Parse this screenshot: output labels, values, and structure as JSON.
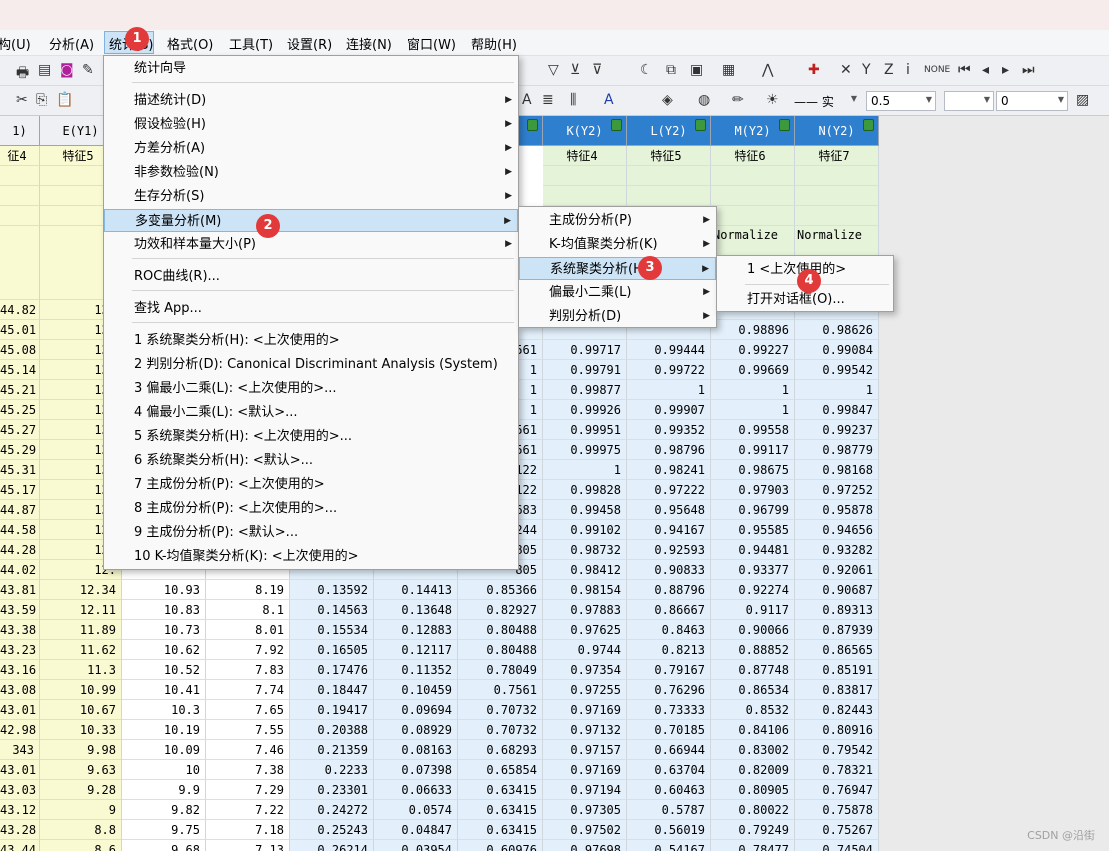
{
  "menubar": {
    "items": [
      "构(U)",
      "分析(A)",
      "统计(S)",
      "格式(O)",
      "工具(T)",
      "设置(R)",
      "连接(N)",
      "窗口(W)",
      "帮助(H)"
    ],
    "active_label": "统计(S)"
  },
  "toolbar": {
    "line_style": "—— 实",
    "line_width": "0.5",
    "number": "0"
  },
  "columns": {
    "left": [
      {
        "name": "1)",
        "label": "征4"
      },
      {
        "name": "E(Y1)",
        "label": "特征5"
      }
    ],
    "right": [
      {
        "name": "K(Y2)",
        "label": "特征4"
      },
      {
        "name": "L(Y2)",
        "label": "特征5"
      },
      {
        "name": "M(Y2)",
        "label": "特征6"
      },
      {
        "name": "N(Y2)",
        "label": "特征7"
      }
    ]
  },
  "extra_header": "Normalize",
  "data_rows": [
    [
      "44.82",
      "13.",
      "",
      "",
      "",
      "",
      "",
      "",
      "",
      "",
      ""
    ],
    [
      "45.01",
      "13.",
      "",
      "",
      "",
      "",
      "",
      "",
      "",
      "0.98896",
      "0.98626"
    ],
    [
      "45.08",
      "13.",
      "",
      "",
      "",
      "",
      "561",
      "0.99717",
      "0.99444",
      "0.99227",
      "0.99084"
    ],
    [
      "45.14",
      "13.",
      "",
      "",
      "",
      "",
      "1",
      "0.99791",
      "0.99722",
      "0.99669",
      "0.99542"
    ],
    [
      "45.21",
      "13.",
      "",
      "",
      "",
      "",
      "1",
      "0.99877",
      "1",
      "1",
      "1"
    ],
    [
      "45.25",
      "13.",
      "",
      "",
      "",
      "",
      "1",
      "0.99926",
      "0.99907",
      "1",
      "0.99847"
    ],
    [
      "45.27",
      "13.",
      "",
      "",
      "",
      "",
      "561",
      "0.99951",
      "0.99352",
      "0.99558",
      "0.99237"
    ],
    [
      "45.29",
      "13.",
      "",
      "",
      "",
      "",
      "561",
      "0.99975",
      "0.98796",
      "0.99117",
      "0.98779"
    ],
    [
      "45.31",
      "13.",
      "",
      "",
      "",
      "",
      "122",
      "1",
      "0.98241",
      "0.98675",
      "0.98168"
    ],
    [
      "45.17",
      "13.",
      "",
      "",
      "",
      "",
      "122",
      "0.99828",
      "0.97222",
      "0.97903",
      "0.97252"
    ],
    [
      "44.87",
      "13.",
      "",
      "",
      "",
      "",
      "683",
      "0.99458",
      "0.95648",
      "0.96799",
      "0.95878"
    ],
    [
      "44.58",
      "12.",
      "",
      "",
      "",
      "",
      "244",
      "0.99102",
      "0.94167",
      "0.95585",
      "0.94656"
    ],
    [
      "44.28",
      "12.",
      "",
      "",
      "",
      "",
      "805",
      "0.98732",
      "0.92593",
      "0.94481",
      "0.93282"
    ],
    [
      "44.02",
      "12.",
      "",
      "",
      "",
      "",
      "805",
      "0.98412",
      "0.90833",
      "0.93377",
      "0.92061"
    ],
    [
      "43.81",
      "12.34",
      "10.93",
      "8.19",
      "0.13592",
      "0.14413",
      "0.85366",
      "0.98154",
      "0.88796",
      "0.92274",
      "0.90687"
    ],
    [
      "43.59",
      "12.11",
      "10.83",
      "8.1",
      "0.14563",
      "0.13648",
      "0.82927",
      "0.97883",
      "0.86667",
      "0.9117",
      "0.89313"
    ],
    [
      "43.38",
      "11.89",
      "10.73",
      "8.01",
      "0.15534",
      "0.12883",
      "0.80488",
      "0.97625",
      "0.8463",
      "0.90066",
      "0.87939"
    ],
    [
      "43.23",
      "11.62",
      "10.62",
      "7.92",
      "0.16505",
      "0.12117",
      "0.80488",
      "0.9744",
      "0.8213",
      "0.88852",
      "0.86565"
    ],
    [
      "43.16",
      "11.3",
      "10.52",
      "7.83",
      "0.17476",
      "0.11352",
      "0.78049",
      "0.97354",
      "0.79167",
      "0.87748",
      "0.85191"
    ],
    [
      "43.08",
      "10.99",
      "10.41",
      "7.74",
      "0.18447",
      "0.10459",
      "0.7561",
      "0.97255",
      "0.76296",
      "0.86534",
      "0.83817"
    ],
    [
      "43.01",
      "10.67",
      "10.3",
      "7.65",
      "0.19417",
      "0.09694",
      "0.70732",
      "0.97169",
      "0.73333",
      "0.8532",
      "0.82443"
    ],
    [
      "42.98",
      "10.33",
      "10.19",
      "7.55",
      "0.20388",
      "0.08929",
      "0.70732",
      "0.97132",
      "0.70185",
      "0.84106",
      "0.80916"
    ],
    [
      "343",
      "9.98",
      "10.09",
      "7.46",
      "0.21359",
      "0.08163",
      "0.68293",
      "0.97157",
      "0.66944",
      "0.83002",
      "0.79542"
    ],
    [
      "43.01",
      "9.63",
      "10",
      "7.38",
      "0.2233",
      "0.07398",
      "0.65854",
      "0.97169",
      "0.63704",
      "0.82009",
      "0.78321"
    ],
    [
      "43.03",
      "9.28",
      "9.9",
      "7.29",
      "0.23301",
      "0.06633",
      "0.63415",
      "0.97194",
      "0.60463",
      "0.80905",
      "0.76947"
    ],
    [
      "43.12",
      "9",
      "9.82",
      "7.22",
      "0.24272",
      "0.0574",
      "0.63415",
      "0.97305",
      "0.5787",
      "0.80022",
      "0.75878"
    ],
    [
      "43.28",
      "8.8",
      "9.75",
      "7.18",
      "0.25243",
      "0.04847",
      "0.63415",
      "0.97502",
      "0.56019",
      "0.79249",
      "0.75267"
    ],
    [
      "43.44",
      "8.6",
      "9.68",
      "7.13",
      "0.26214",
      "0.03954",
      "0.60976",
      "0.97698",
      "0.54167",
      "0.78477",
      "0.74504"
    ]
  ],
  "main_menu": {
    "items": [
      {
        "label": "统计向导",
        "arrow": false
      },
      {
        "label": "描述统计(D)",
        "arrow": true
      },
      {
        "label": "假设检验(H)",
        "arrow": true
      },
      {
        "label": "方差分析(A)",
        "arrow": true
      },
      {
        "label": "非参数检验(N)",
        "arrow": true
      },
      {
        "label": "生存分析(S)",
        "arrow": true
      },
      {
        "label": "多变量分析(M)",
        "arrow": true
      },
      {
        "label": "功效和样本量大小(P)",
        "arrow": true
      },
      {
        "label": "ROC曲线(R)...",
        "arrow": false
      },
      {
        "label": "查找 App...",
        "arrow": false
      },
      {
        "label": "1 系统聚类分析(H): <上次使用的>",
        "arrow": false
      },
      {
        "label": "2 判别分析(D): Canonical Discriminant Analysis (System)",
        "arrow": false
      },
      {
        "label": "3 偏最小二乘(L): <上次使用的>...",
        "arrow": false
      },
      {
        "label": "4 偏最小二乘(L): <默认>...",
        "arrow": false
      },
      {
        "label": "5 系统聚类分析(H): <上次使用的>...",
        "arrow": false
      },
      {
        "label": "6 系统聚类分析(H): <默认>...",
        "arrow": false
      },
      {
        "label": "7 主成份分析(P): <上次使用的>",
        "arrow": false
      },
      {
        "label": "8 主成份分析(P): <上次使用的>...",
        "arrow": false
      },
      {
        "label": "9 主成份分析(P): <默认>...",
        "arrow": false
      },
      {
        "label": "10 K-均值聚类分析(K): <上次使用的>",
        "arrow": false
      }
    ]
  },
  "sub_menu": {
    "items": [
      "主成份分析(P)",
      "K-均值聚类分析(K)",
      "系统聚类分析(H)",
      "偏最小二乘(L)",
      "判别分析(D)"
    ]
  },
  "sub_sub_menu": {
    "items": [
      "1 <上次使用的>",
      "打开对话框(O)..."
    ]
  },
  "badges": [
    "1",
    "2",
    "3",
    "4"
  ],
  "watermark": "CSDN @沿街"
}
